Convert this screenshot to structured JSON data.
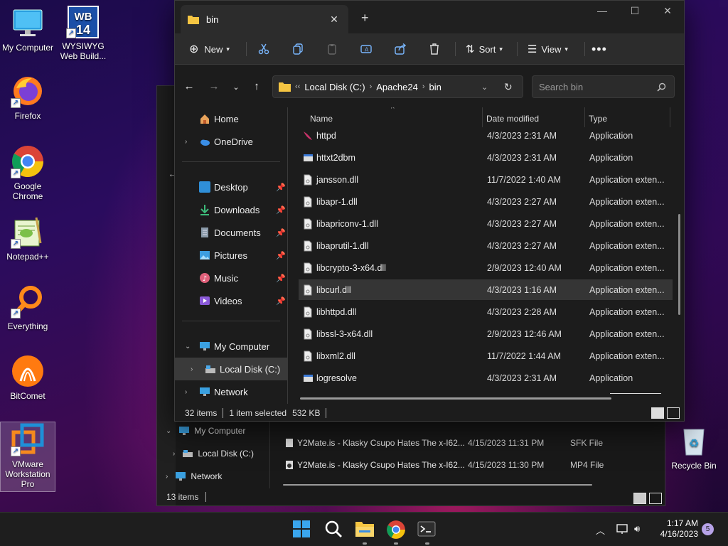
{
  "desktop": {
    "icons": [
      {
        "name": "my-computer",
        "label": "My Computer"
      },
      {
        "name": "wysiwyg",
        "label": "WYSIWYG Web Build...",
        "logo": "WB 14"
      },
      {
        "name": "firefox",
        "label": "Firefox"
      },
      {
        "name": "chrome",
        "label": "Google Chrome"
      },
      {
        "name": "notepadpp",
        "label": "Notepad++"
      },
      {
        "name": "everything",
        "label": "Everything"
      },
      {
        "name": "bitcomet",
        "label": "BitComet"
      },
      {
        "name": "vmware",
        "label": "VMware Workstation Pro"
      },
      {
        "name": "recycle-bin",
        "label": "Recycle Bin"
      }
    ]
  },
  "bg_window": {
    "nav": [
      {
        "label": "My Computer",
        "expanded": true
      },
      {
        "label": "Local Disk (C:)"
      },
      {
        "label": "Network"
      }
    ],
    "files": [
      {
        "name": "Y2Mate.is - Klasky Csupo Hates The x-I62...",
        "date": "4/15/2023 11:31 PM",
        "type": "SFK File"
      },
      {
        "name": "Y2Mate.is - Klasky Csupo Hates The x-I62...",
        "date": "4/15/2023 11:30 PM",
        "type": "MP4 File"
      }
    ],
    "status": "13 items"
  },
  "window": {
    "tab_title": "bin",
    "toolbar": {
      "new_label": "New",
      "sort_label": "Sort",
      "view_label": "View"
    },
    "address": {
      "crumbs": [
        "Local Disk (C:)",
        "Apache24",
        "bin"
      ]
    },
    "search": {
      "placeholder": "Search bin"
    },
    "nav": {
      "home": "Home",
      "onedrive": "OneDrive",
      "quick": [
        {
          "label": "Desktop",
          "icon": "desktop-icon",
          "color": "#2f8fd8"
        },
        {
          "label": "Downloads",
          "icon": "download-icon",
          "color": "#3dbb7a"
        },
        {
          "label": "Documents",
          "icon": "documents-icon",
          "color": "#8a9aa8"
        },
        {
          "label": "Pictures",
          "icon": "pictures-icon",
          "color": "#3d9ee0"
        },
        {
          "label": "Music",
          "icon": "music-icon",
          "color": "#e0607a"
        },
        {
          "label": "Videos",
          "icon": "videos-icon",
          "color": "#8a5ad8"
        }
      ],
      "my_computer": "My Computer",
      "local_disk": "Local Disk (C:)",
      "network": "Network"
    },
    "columns": {
      "name": "Name",
      "date": "Date modified",
      "type": "Type"
    },
    "files": [
      {
        "name": "httpd",
        "date": "4/3/2023 2:31 AM",
        "type": "Application",
        "kind": "app-feather"
      },
      {
        "name": "httxt2dbm",
        "date": "4/3/2023 2:31 AM",
        "type": "Application",
        "kind": "app"
      },
      {
        "name": "jansson.dll",
        "date": "11/7/2022 1:40 AM",
        "type": "Application exten...",
        "kind": "dll"
      },
      {
        "name": "libapr-1.dll",
        "date": "4/3/2023 2:27 AM",
        "type": "Application exten...",
        "kind": "dll"
      },
      {
        "name": "libapriconv-1.dll",
        "date": "4/3/2023 2:27 AM",
        "type": "Application exten...",
        "kind": "dll"
      },
      {
        "name": "libaprutil-1.dll",
        "date": "4/3/2023 2:27 AM",
        "type": "Application exten...",
        "kind": "dll"
      },
      {
        "name": "libcrypto-3-x64.dll",
        "date": "2/9/2023 12:40 AM",
        "type": "Application exten...",
        "kind": "dll"
      },
      {
        "name": "libcurl.dll",
        "date": "4/3/2023 1:16 AM",
        "type": "Application exten...",
        "kind": "dll",
        "selected": true
      },
      {
        "name": "libhttpd.dll",
        "date": "4/3/2023 2:28 AM",
        "type": "Application exten...",
        "kind": "dll"
      },
      {
        "name": "libssl-3-x64.dll",
        "date": "2/9/2023 12:46 AM",
        "type": "Application exten...",
        "kind": "dll"
      },
      {
        "name": "libxml2.dll",
        "date": "11/7/2022 1:44 AM",
        "type": "Application exten...",
        "kind": "dll"
      },
      {
        "name": "logresolve",
        "date": "4/3/2023 2:31 AM",
        "type": "Application",
        "kind": "app"
      }
    ],
    "status": {
      "items": "32 items",
      "selected": "1 item selected",
      "size": "532 KB"
    }
  },
  "taskbar": {
    "apps": [
      "start-icon",
      "search-icon",
      "file-explorer-icon",
      "chrome-icon",
      "terminal-icon"
    ],
    "time": "1:17 AM",
    "date": "4/16/2023",
    "notification_count": "5"
  }
}
